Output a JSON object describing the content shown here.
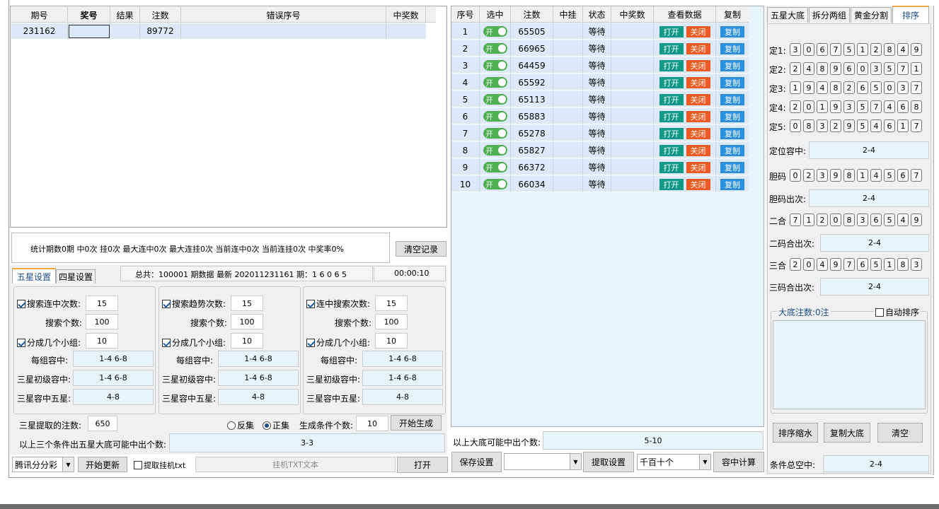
{
  "left_table": {
    "headers": [
      "期号",
      "奖号",
      "结果",
      "注数",
      "错误序号",
      "中奖数"
    ],
    "rows": [
      {
        "period": "231162",
        "draw": "",
        "result": "",
        "count": "89772",
        "err": "",
        "wins": ""
      }
    ]
  },
  "stats": {
    "text": "统计期数0期  中0次  挂0次  最大连中0次  最大连挂0次  当前连中0次  当前连挂0次  中奖率0%",
    "clear_btn": "清空记录"
  },
  "settings_tabs": [
    "五星设置",
    "四星设置"
  ],
  "summary": {
    "text": "总共：100001 期数据   最新 202011231161 期：1 6 0 6 5",
    "timer": "00:00:10"
  },
  "groups": [
    {
      "c1_label": "搜索连中次数:",
      "c1_val": "15",
      "c2_label": "搜索个数:",
      "c2_val": "100",
      "c3_label": "分成几个小组:",
      "c3_val": "10",
      "r1_label": "每组容中:",
      "r1_val": "1-4 6-8",
      "r2_label": "三星初级容中:",
      "r2_val": "1-4 6-8",
      "r3_label": "三星容中五星:",
      "r3_val": "4-8"
    },
    {
      "c1_label": "搜索趋势次数:",
      "c1_val": "15",
      "c2_label": "搜索个数:",
      "c2_val": "100",
      "c3_label": "分成几个小组:",
      "c3_val": "10",
      "r1_label": "每组容中:",
      "r1_val": "1-4 6-8",
      "r2_label": "三星初级容中:",
      "r2_val": "1-4 6-8",
      "r3_label": "三星容中五星:",
      "r3_val": "4-8"
    },
    {
      "c1_label": "连中搜索次数:",
      "c1_val": "15",
      "c2_label": "搜索个数:",
      "c2_val": "100",
      "c3_label": "分成几个小组:",
      "c3_val": "10",
      "r1_label": "每组容中:",
      "r1_val": "1-4 6-8",
      "r2_label": "三星初级容中:",
      "r2_val": "1-4 6-8",
      "r3_label": "三星容中五星:",
      "r3_val": "4-8"
    }
  ],
  "extract": {
    "label": "三星提取的注数:",
    "value": "650",
    "radio1": "反集",
    "radio2": "正集",
    "cond_label": "生成条件个数:",
    "cond_val": "10",
    "gen_btn": "开始生成",
    "possible_label": "以上三个条件出五星大底可能中出个数:",
    "possible_val": "3-3"
  },
  "bottom_bar": {
    "lottery": "腾讯分分彩",
    "update_btn": "开始更新",
    "extract_chk": "提取挂机txt",
    "txt_placeholder": "挂机TXT文本",
    "open_btn": "打开"
  },
  "mid_table": {
    "headers": [
      "序号",
      "选中",
      "注数",
      "中挂",
      "状态",
      "中奖数",
      "查看数据",
      "复制"
    ],
    "toggle": "开",
    "open": "打开",
    "close": "关闭",
    "copy": "复制",
    "rows": [
      {
        "n": "1",
        "count": "65505",
        "status": "等待"
      },
      {
        "n": "2",
        "count": "66965",
        "status": "等待"
      },
      {
        "n": "3",
        "count": "64459",
        "status": "等待"
      },
      {
        "n": "4",
        "count": "65592",
        "status": "等待"
      },
      {
        "n": "5",
        "count": "65113",
        "status": "等待"
      },
      {
        "n": "6",
        "count": "65883",
        "status": "等待"
      },
      {
        "n": "7",
        "count": "65278",
        "status": "等待"
      },
      {
        "n": "8",
        "count": "65827",
        "status": "等待"
      },
      {
        "n": "9",
        "count": "66372",
        "status": "等待"
      },
      {
        "n": "10",
        "count": "66034",
        "status": "等待"
      }
    ]
  },
  "mid_bottom": {
    "possible_label": "以上大底可能中出个数:",
    "possible_val": "5-10",
    "save_btn": "保存设置",
    "extract_btn": "提取设置",
    "select2": "千百十个",
    "calc_btn": "容中计算"
  },
  "right_tabs": [
    "五星大底",
    "拆分两组",
    "黄金分割",
    "排序"
  ],
  "positions": [
    {
      "label": "定1:",
      "digits": [
        "3",
        "0",
        "6",
        "7",
        "5",
        "1",
        "2",
        "8",
        "4",
        "9"
      ]
    },
    {
      "label": "定2:",
      "digits": [
        "2",
        "4",
        "8",
        "9",
        "6",
        "0",
        "3",
        "5",
        "7",
        "1"
      ]
    },
    {
      "label": "定3:",
      "digits": [
        "1",
        "9",
        "4",
        "8",
        "2",
        "6",
        "5",
        "0",
        "3",
        "7"
      ]
    },
    {
      "label": "定4:",
      "digits": [
        "2",
        "0",
        "1",
        "9",
        "3",
        "5",
        "7",
        "4",
        "6",
        "8"
      ]
    },
    {
      "label": "定5:",
      "digits": [
        "0",
        "8",
        "3",
        "2",
        "9",
        "5",
        "4",
        "6",
        "1",
        "7"
      ]
    }
  ],
  "pos_hit": {
    "label": "定位容中:",
    "val": "2-4"
  },
  "dan": {
    "label": "胆码",
    "digits": [
      "0",
      "2",
      "3",
      "9",
      "8",
      "1",
      "4",
      "5",
      "6",
      "7"
    ]
  },
  "dan_hit": {
    "label": "胆码出次:",
    "val": "2-4"
  },
  "two": {
    "label": "二合",
    "digits": [
      "7",
      "1",
      "2",
      "0",
      "8",
      "3",
      "6",
      "5",
      "4",
      "9"
    ]
  },
  "two_hit": {
    "label": "二码合出次:",
    "val": "2-4"
  },
  "three": {
    "label": "三合",
    "digits": [
      "2",
      "0",
      "4",
      "9",
      "7",
      "6",
      "5",
      "1",
      "8",
      "3"
    ]
  },
  "three_hit": {
    "label": "三码合出次:",
    "val": "2-4"
  },
  "dadi": {
    "label": "大底注数:0注",
    "auto": "自动排序"
  },
  "right_btns": {
    "shrink": "排序缩水",
    "copy": "复制大底",
    "clear": "清空"
  },
  "total": {
    "label": "条件总空中:",
    "val": "2-4"
  }
}
